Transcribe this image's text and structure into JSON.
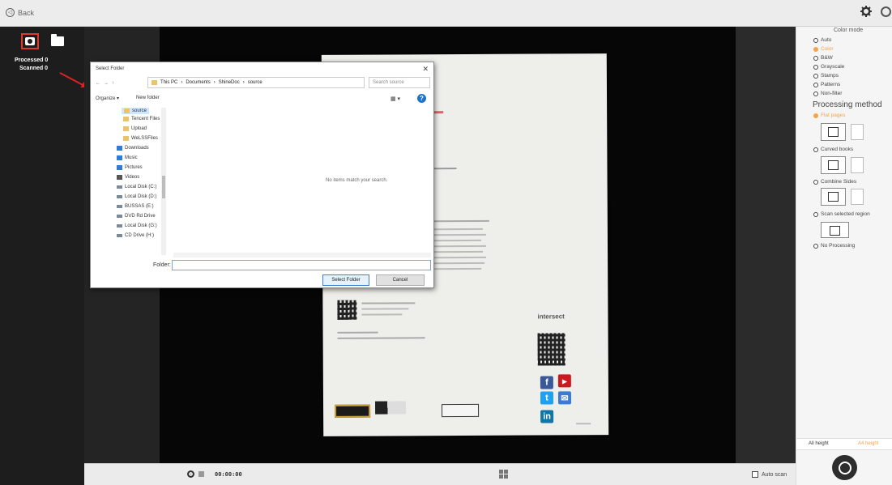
{
  "topbar": {
    "back_label": "Back",
    "back_icon": "back-arrow-circle-icon"
  },
  "leftpanel": {
    "processed_label": "Processed",
    "processed_count": "0",
    "scanned_label": "Scanned",
    "scanned_count": "0"
  },
  "dialog": {
    "title": "Select Folder",
    "breadcrumb": [
      "This PC",
      "Documents",
      "ShineDoc",
      "source"
    ],
    "search_placeholder": "Search source",
    "organize_label": "Organize ▾",
    "new_folder_label": "New folder",
    "nav_items": [
      "source",
      "Tencent Files",
      "Upload",
      "WeLSSFiles",
      "Downloads",
      "Music",
      "Pictures",
      "Videos",
      "Local Disk (C:)",
      "Local Disk (D:)",
      "BUSSAS (E:)",
      "DVD Rd Drive",
      "Local Disk (G:)",
      "CD Drive (H:)"
    ],
    "empty_message": "No items match your search.",
    "folder_label": "Folder:",
    "folder_value": "",
    "select_button": "Select Folder",
    "cancel_button": "Cancel"
  },
  "document": {
    "brand_text": "intersect"
  },
  "rightpanel": {
    "color_mode_title": "Color mode",
    "color_modes": [
      "Auto",
      "Color",
      "B&W",
      "Grayscale",
      "Stamps",
      "Patterns",
      "Non-filter"
    ],
    "color_mode_selected": "Color",
    "processing_title": "Processing method",
    "processing_methods": [
      "Flat pages",
      "Curved books",
      "Combine Sides",
      "Scan selected region",
      "No Processing"
    ],
    "processing_selected": "Flat pages",
    "tab_all_height": "All height",
    "tab_a4_height": "A4 height"
  },
  "bottombar": {
    "timer": "00:00:00",
    "auto_scan_label": "Auto scan",
    "auto_scan_checked": false
  }
}
